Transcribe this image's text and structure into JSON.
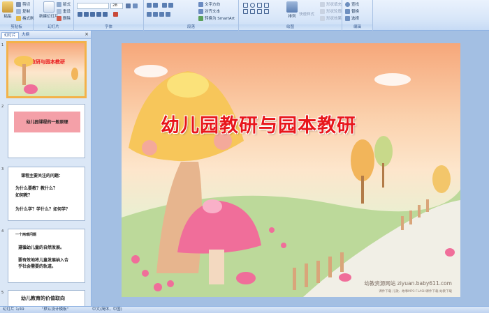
{
  "ribbon": {
    "groups": [
      {
        "label": "剪贴板",
        "buttons": [
          "粘贴",
          "剪切",
          "复制",
          "格式刷"
        ]
      },
      {
        "label": "幻灯片",
        "buttons": [
          "新建幻灯片",
          "版式",
          "重设",
          "删除"
        ]
      },
      {
        "label": "字体",
        "font_size": "28"
      },
      {
        "label": "段落",
        "buttons": [
          "文字方向",
          "对齐文本",
          "转换为 SmartArt"
        ]
      },
      {
        "label": "绘图",
        "buttons": [
          "排列",
          "快速样式",
          "形状填充",
          "形状轮廓",
          "形状效果"
        ]
      },
      {
        "label": "编辑",
        "buttons": [
          "查找",
          "替换",
          "选择"
        ]
      }
    ]
  },
  "pane": {
    "tabs": [
      "幻灯片",
      "大纲"
    ],
    "close": "×"
  },
  "slides": [
    {
      "num": "1",
      "title": "幼儿园教研与园本教研"
    },
    {
      "num": "2",
      "lines": [
        "幼儿园课程的一般原理"
      ]
    },
    {
      "num": "3",
      "lines": [
        "课程主要关注的问题：",
        "为什么要教？教什么？",
        "如何教？",
        "为什么学？学什么？如何学？"
      ]
    },
    {
      "num": "4",
      "lines": [
        "一个两难问题",
        "遵循幼儿童的自然发展。",
        "要有效地将儿童发展纳入合",
        "乎社会需要的轨道。"
      ]
    },
    {
      "num": "5",
      "lines": [
        "幼儿教育的价值取向"
      ]
    }
  ],
  "main_slide": {
    "title": "幼儿园教研与园本教研",
    "watermark": "幼教资源网站  ziyuan.baby611.com",
    "watermark_sub": "课件下载  儿歌、故事MP3  FLASH课件下载  幼教下载"
  },
  "status_bar": {
    "slide_counter": "幻灯片 1/49",
    "theme": "\"默认设计模板\"",
    "language": "中文(简体，中国)"
  },
  "colors": {
    "title_red": "#e8161b",
    "accent_orange": "#f3b24a",
    "ribbon_blue": "#dbe7f6"
  }
}
